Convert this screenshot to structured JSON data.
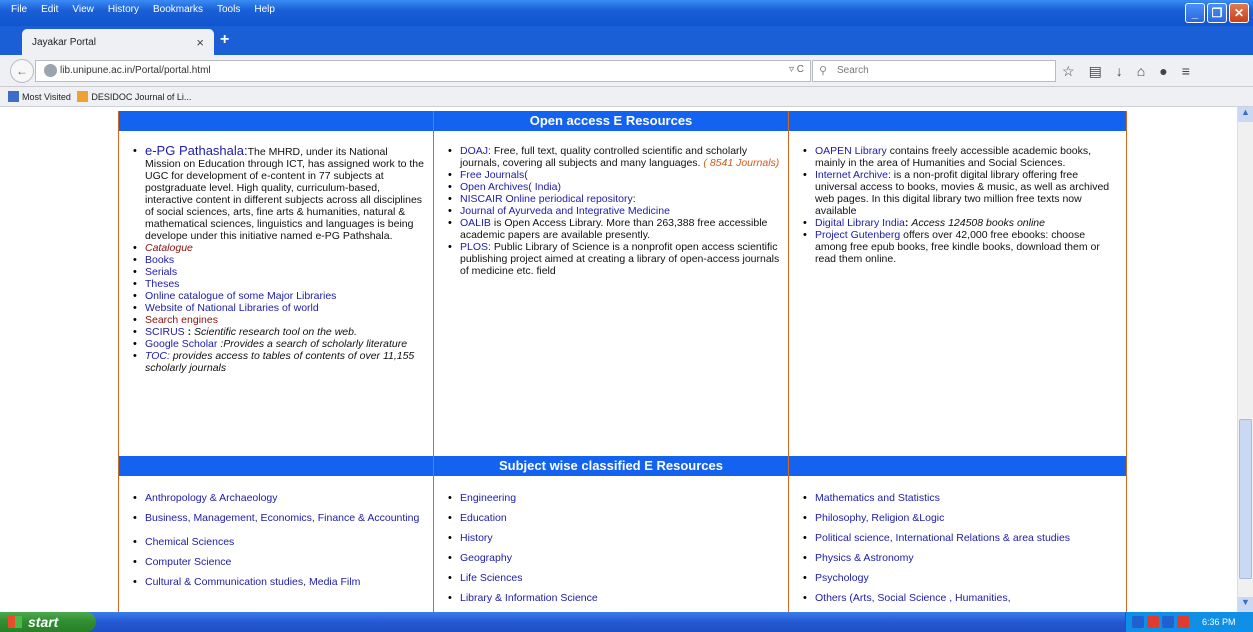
{
  "browser": {
    "menu": [
      "File",
      "Edit",
      "View",
      "History",
      "Bookmarks",
      "Tools",
      "Help"
    ],
    "tab_title": "Jayakar Portal",
    "url": "lib.unipune.ac.in/Portal/portal.html",
    "search_placeholder": "Search",
    "bookmarks": [
      "Most Visited",
      "DESIDOC Journal of Li..."
    ]
  },
  "open_access": {
    "header": "Open access E Resources",
    "col1": {
      "epg_link": "e-PG Pathashala:",
      "epg_text": "The MHRD, under its National Mission on Education through ICT, has assigned work to the UGC for development of e-content in 77 subjects at postgraduate level. High quality, curriculum-based, interactive content in different subjects across all disciplines of social sciences, arts, fine arts & humanities, natural & mathematical sciences, linguistics and languages is being develope under this initiative named e-PG Pathshala.",
      "catalogue": "Catalogue",
      "books": "Books",
      "serials": "Serials",
      "theses": "Theses",
      "online_catalogue": "Online catalogue of some Major Libraries",
      "national_libraries": "Website of National Libraries of world",
      "search_engines": "Search engines",
      "scirus_link": "SCIRUS",
      "scirus_text": "Scientific research tool on the web.",
      "scholar_link": "Google Scholar",
      "scholar_text": ":Provides a search of scholarly literature",
      "toc_link": "TOC:",
      "toc_text": "provides access to tables of contents of over 11,155 scholarly journals"
    },
    "col2": {
      "doaj_link": "DOAJ:",
      "doaj_text": "Free, full text, quality controlled scientific and scholarly journals, covering all subjects and many languages.",
      "doaj_count": "( 8541  Journals)",
      "free_journals": "Free Journals(",
      "open_archives": "Open Archives( India)",
      "niscair": "NISCAIR Online periodical repository",
      "ayurveda": "Journal of Ayurveda and Integrative Medicine",
      "oalib_link": "OALIB",
      "oalib_text": "is Open Access Library.  More than 263,388 free accessible academic papers are available presently.",
      "plos_link": "PLOS:",
      "plos_text": "Public Library of Science  is a nonprofit open access scientific publishing project aimed at creating a library of open-access journals of  medicine etc. field"
    },
    "col3": {
      "oapen_link": "OAPEN Library",
      "oapen_text": "contains freely accessible academic books, mainly in the area of Humanities and Social Sciences.",
      "archive_link": "Internet Archive",
      "archive_text": ": is a non-profit digital library offering free universal access to books, movies & music, as well as archived web pages. In this digital library  two million free texts now available",
      "dli_link": "Digital Library India",
      "dli_text": "Access 124508   books online",
      "gutenberg_link": "Project Gutenberg",
      "gutenberg_text": "offers over 42,000 free ebooks: choose among free epub books, free kindle books, download them or read them online."
    }
  },
  "subject_wise": {
    "header": "Subject wise classified E Resources",
    "col1": [
      "Anthropology & Archaeology",
      "Business, Management, Economics,  Finance & Accounting",
      "Chemical Sciences",
      "Computer Science",
      "Cultural & Communication studies, Media Film"
    ],
    "col2": [
      "Engineering",
      "Education",
      "History",
      "Geography",
      "Life Sciences",
      "Library & Information Science"
    ],
    "col3": [
      "Mathematics and Statistics",
      "Philosophy, Religion &Logic",
      "Political science, International Relations & area studies",
      "Physics & Astronomy",
      "Psychology",
      "Others (Arts, Social Science , Humanities,"
    ]
  },
  "taskbar": {
    "start": "start",
    "clock": "6:36 PM"
  }
}
